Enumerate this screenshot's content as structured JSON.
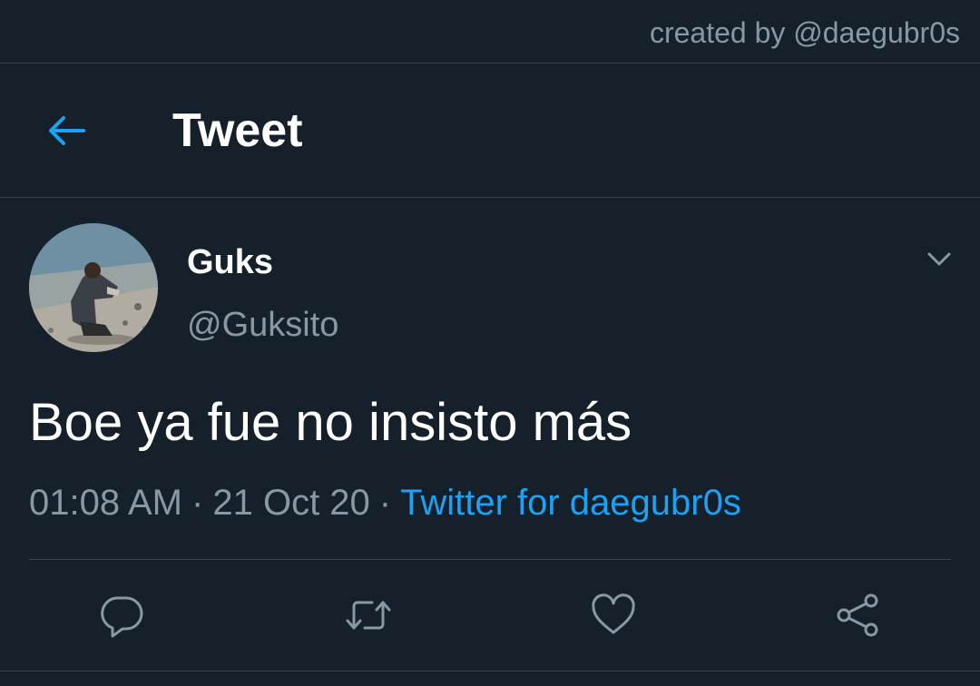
{
  "credit": "created by @daegubr0s",
  "header": {
    "back_icon": "arrow-left-icon",
    "title": "Tweet"
  },
  "author": {
    "display_name": "Guks",
    "handle": "@Guksito",
    "avatar_icon": "profile-photo"
  },
  "tweet": {
    "text": "Boe ya fue no insisto más",
    "time": "01:08 AM",
    "date": "21 Oct 20",
    "source": "Twitter for daegubr0s",
    "separator": "·"
  },
  "actions": [
    "reply-icon",
    "retweet-icon",
    "like-icon",
    "share-icon"
  ],
  "colors": {
    "background": "#15202b",
    "accent": "#1da1f2",
    "muted": "#8899a6",
    "divider": "#38444d"
  }
}
